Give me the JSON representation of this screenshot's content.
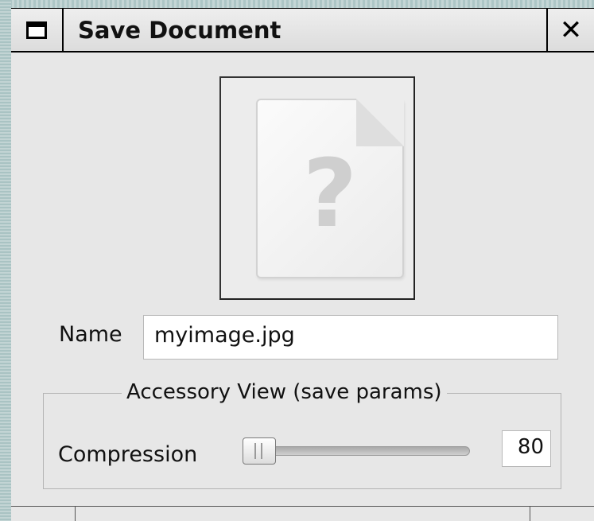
{
  "window": {
    "title": "Save Document",
    "menu_icon": "window-menu-icon",
    "close_glyph": "✕",
    "close_icon": "close-icon"
  },
  "preview": {
    "icon": "unknown-file-icon",
    "glyph": "?"
  },
  "form": {
    "name_label": "Name",
    "name_value": "myimage.jpg"
  },
  "accessory": {
    "legend": "Accessory View (save params)",
    "compression_label": "Compression",
    "compression_value": "80"
  }
}
